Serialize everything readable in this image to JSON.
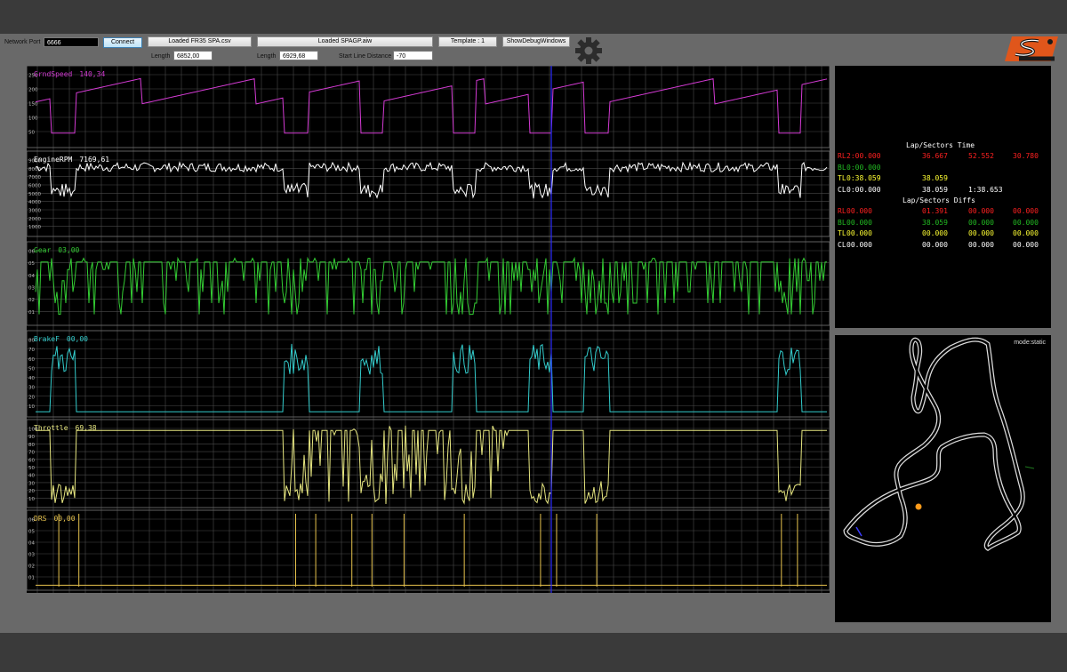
{
  "toolbar": {
    "network_port_label": "Network Port",
    "network_port_value": "6666",
    "connect_label": "Connect",
    "loaded_file_1": "Loaded FR35 SPA.csv",
    "loaded_file_2": "Loaded SPAGP.aiw",
    "template_label": "Template : 1",
    "debug_label": "ShowDebugWindows",
    "length_label": "Length",
    "length_1": "6852,00",
    "length_2": "6929,68",
    "start_line_label": "Start Line Distance",
    "start_line_value": "-70",
    "settings_icon": "gear-icon",
    "logo_text": "simtech"
  },
  "channels": [
    {
      "name": "GrndSpeed",
      "value": "140,34",
      "color": "#d33ad3",
      "ticks": [
        "250",
        "200",
        "150",
        "100",
        "50"
      ]
    },
    {
      "name": "EngineRPM",
      "value": "7169,61",
      "color": "#ffffff",
      "ticks": [
        "9000",
        "8000",
        "7000",
        "6000",
        "5000",
        "4000",
        "3000",
        "2000",
        "1000"
      ]
    },
    {
      "name": "Gear",
      "value": "03,00",
      "color": "#33cc33",
      "ticks": [
        "06",
        "05",
        "04",
        "03",
        "02",
        "01"
      ]
    },
    {
      "name": "BrakeF",
      "value": "00,00",
      "color": "#33cccc",
      "ticks": [
        "80",
        "70",
        "60",
        "50",
        "40",
        "30",
        "20",
        "10"
      ]
    },
    {
      "name": "Throttle",
      "value": "69,38",
      "color": "#e6e680",
      "ticks": [
        "100",
        "90",
        "80",
        "70",
        "60",
        "50",
        "40",
        "30",
        "20",
        "10"
      ]
    },
    {
      "name": "DRS",
      "value": "00,00",
      "color": "#e6c24d",
      "ticks": [
        "06",
        "05",
        "04",
        "03",
        "02",
        "01"
      ]
    }
  ],
  "timing": {
    "title": "Lap/Sectors Time",
    "rows": [
      {
        "tag": "RL",
        "c1": "2:00.000",
        "c2": "36.667",
        "c3": "52.552",
        "c4": "30.780",
        "color": "#ff2020"
      },
      {
        "tag": "BL",
        "c1": "0:00.000",
        "c2": "",
        "c3": "",
        "c4": "",
        "color": "#22bb22"
      },
      {
        "tag": "TL",
        "c1": "0:38.059",
        "c2": "38.059",
        "c3": "",
        "c4": "",
        "color": "#ffff33"
      },
      {
        "tag": "CL",
        "c1": "0:00.000",
        "c2": "38.059",
        "c3": "1:38.653",
        "c4": "",
        "color": "#ffffff"
      }
    ],
    "diffs_title": "Lap/Sectors Diffs",
    "diffs": [
      {
        "tag": "RL",
        "c1": "00.000",
        "c2": "01.391",
        "c3": "00.000",
        "c4": "00.000",
        "color": "#ff2020"
      },
      {
        "tag": "BL",
        "c1": "00.000",
        "c2": "38.059",
        "c3": "00.000",
        "c4": "00.000",
        "color": "#22bb22"
      },
      {
        "tag": "TL",
        "c1": "00.000",
        "c2": "00.000",
        "c3": "00.000",
        "c4": "00.000",
        "color": "#ffff33"
      },
      {
        "tag": "CL",
        "c1": "00.000",
        "c2": "00.000",
        "c3": "00.000",
        "c4": "00.000",
        "color": "#ffffff"
      }
    ]
  },
  "map": {
    "mode": "mode:static"
  }
}
